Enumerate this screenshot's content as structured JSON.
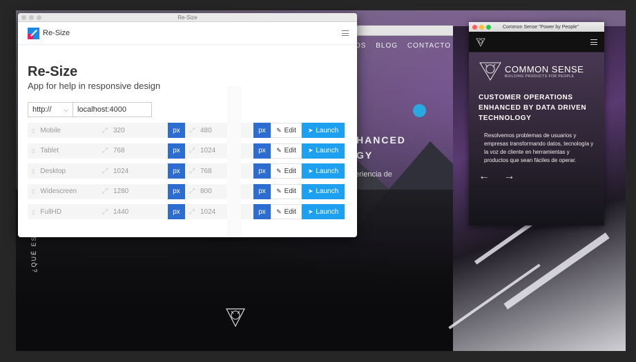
{
  "app": {
    "window_title": "Re-Size",
    "brand_name": "Re-Size",
    "title": "Re-Size",
    "subtitle": "App for help in responsive design",
    "protocol": "http://",
    "host": "localhost:4000",
    "unit_label": "px",
    "edit_label": "Edit",
    "launch_label": "Launch",
    "devices": [
      {
        "name": "Mobile",
        "width": "320",
        "height": "480"
      },
      {
        "name": "Tablet",
        "width": "768",
        "height": "1024"
      },
      {
        "name": "Desktop",
        "width": "1024",
        "height": "768"
      },
      {
        "name": "Widescreen",
        "width": "1280",
        "height": "800"
      },
      {
        "name": "FullHD",
        "width": "1440",
        "height": "1024"
      }
    ],
    "colors": {
      "px_button": "#2d6cd0",
      "launch_button": "#1ea0f0"
    }
  },
  "mid_site": {
    "nav": [
      "OS",
      "BLOG",
      "CONTACTO"
    ],
    "headline": [
      "HANCED",
      "GY"
    ],
    "sub": "eriencia de",
    "vertical": "¿QUÉ ES"
  },
  "common_sense": {
    "window_title": "Common Sense \"Power by People\"",
    "brand": "COMMON SENSE",
    "tagline": "BUILDING PRODUCTS FOR PEOPLE",
    "headline": "CUSTOMER OPERATIONS ENHANCED BY DATA DRIVEN TECHNOLOGY",
    "body": "Resolvemos problemas de usuarios y empresas transformando datos, tecnología y la voz de cliente en herramientas y productos que sean fáciles de operar.",
    "arrows": "← →"
  }
}
